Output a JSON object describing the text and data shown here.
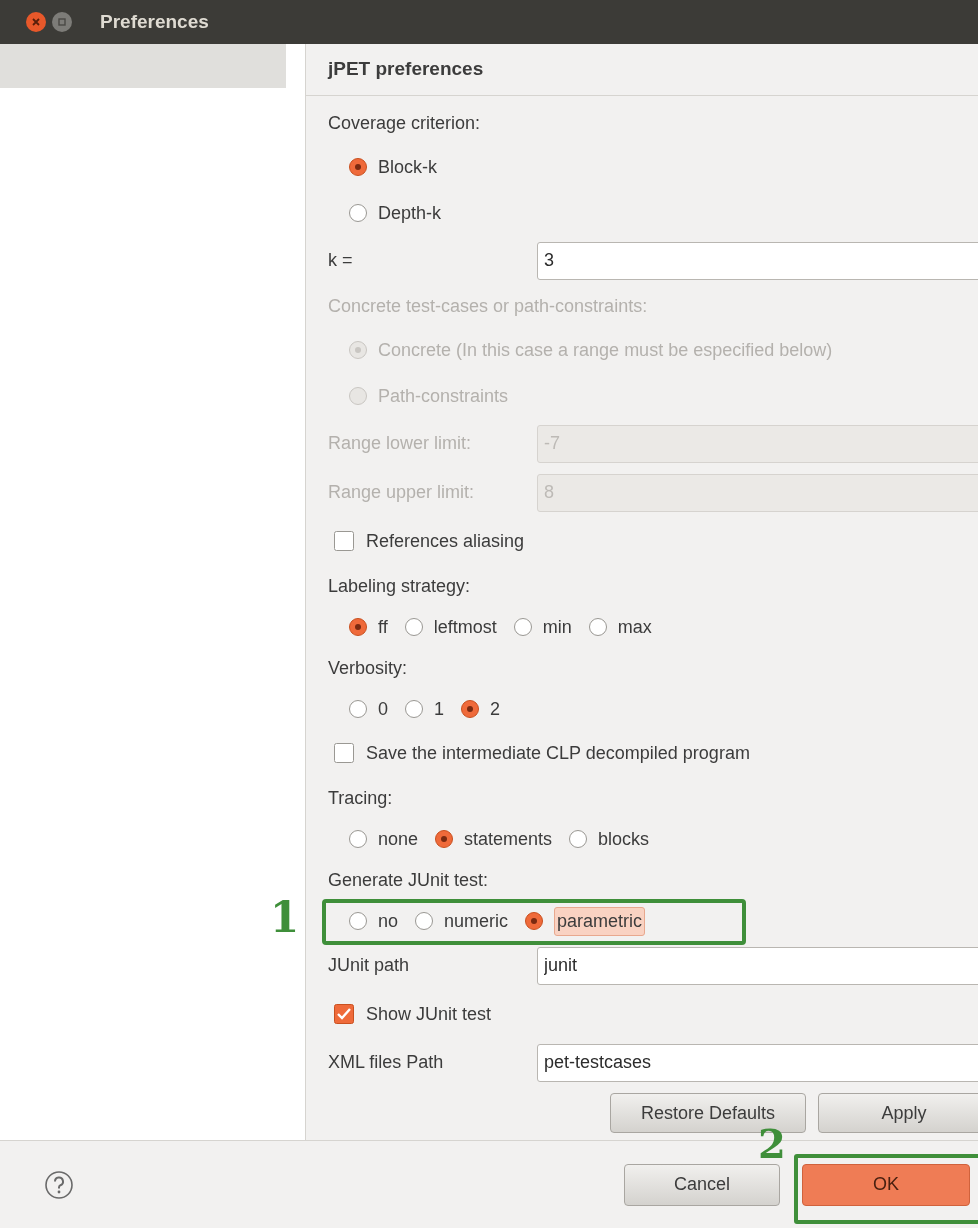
{
  "window": {
    "title": "Preferences"
  },
  "sidebar": {
    "items": [
      {
        "selected": true
      }
    ]
  },
  "page": {
    "title": "jPET preferences"
  },
  "rows": [
    {
      "kind": "label",
      "text": "Coverage criterion:",
      "disabled": false
    },
    {
      "kind": "radio_column",
      "items": [
        {
          "label": "Block-k",
          "selected": true,
          "disabled": false
        },
        {
          "label": "Depth-k",
          "selected": false,
          "disabled": false
        }
      ]
    },
    {
      "kind": "field",
      "label": "k =",
      "value": "3",
      "disabled": false
    },
    {
      "kind": "label",
      "text": "Concrete test-cases or path-constraints:",
      "disabled": true
    },
    {
      "kind": "radio_column",
      "items": [
        {
          "label": "Concrete (In this case a range must be especified below)",
          "selected": true,
          "disabled": true
        },
        {
          "label": "Path-constraints",
          "selected": false,
          "disabled": true
        }
      ]
    },
    {
      "kind": "field",
      "label": "Range lower limit:",
      "value": "-7",
      "disabled": true
    },
    {
      "kind": "field",
      "label": "Range upper limit:",
      "value": "8",
      "disabled": true
    },
    {
      "kind": "checkbox",
      "label": "References aliasing",
      "checked": false
    },
    {
      "kind": "label",
      "text": "Labeling strategy:",
      "disabled": false
    },
    {
      "kind": "radio_row",
      "items": [
        {
          "label": "ff",
          "selected": true,
          "disabled": false
        },
        {
          "label": "leftmost",
          "selected": false,
          "disabled": false
        },
        {
          "label": "min",
          "selected": false,
          "disabled": false
        },
        {
          "label": "max",
          "selected": false,
          "disabled": false
        }
      ]
    },
    {
      "kind": "label",
      "text": "Verbosity:",
      "disabled": false
    },
    {
      "kind": "radio_row",
      "items": [
        {
          "label": "0",
          "selected": false,
          "disabled": false
        },
        {
          "label": "1",
          "selected": false,
          "disabled": false
        },
        {
          "label": "2",
          "selected": true,
          "disabled": false
        }
      ]
    },
    {
      "kind": "checkbox",
      "label": "Save the intermediate CLP decompiled program",
      "checked": false
    },
    {
      "kind": "label",
      "text": "Tracing:",
      "disabled": false
    },
    {
      "kind": "radio_row",
      "items": [
        {
          "label": "none",
          "selected": false,
          "disabled": false
        },
        {
          "label": "statements",
          "selected": true,
          "disabled": false
        },
        {
          "label": "blocks",
          "selected": false,
          "disabled": false
        }
      ]
    },
    {
      "kind": "label",
      "text": "Generate JUnit test:",
      "disabled": false
    },
    {
      "kind": "radio_row",
      "annotation": "1",
      "items": [
        {
          "label": "no",
          "selected": false,
          "disabled": false,
          "focused": false
        },
        {
          "label": "numeric",
          "selected": false,
          "disabled": false,
          "focused": false
        },
        {
          "label": "parametric",
          "selected": true,
          "disabled": false,
          "focused": true
        }
      ]
    },
    {
      "kind": "field",
      "label": "JUnit path",
      "value": "junit",
      "disabled": false
    },
    {
      "kind": "checkbox",
      "label": "Show JUnit test",
      "checked": true
    },
    {
      "kind": "field",
      "label": "XML files Path",
      "value": "pet-testcases",
      "disabled": false
    }
  ],
  "page_buttons": [
    {
      "label": "Restore Defaults"
    },
    {
      "label": "Apply"
    }
  ],
  "dialog_buttons": [
    {
      "label": "Cancel",
      "default": false
    },
    {
      "label": "OK",
      "default": true,
      "annotation": "2"
    }
  ]
}
